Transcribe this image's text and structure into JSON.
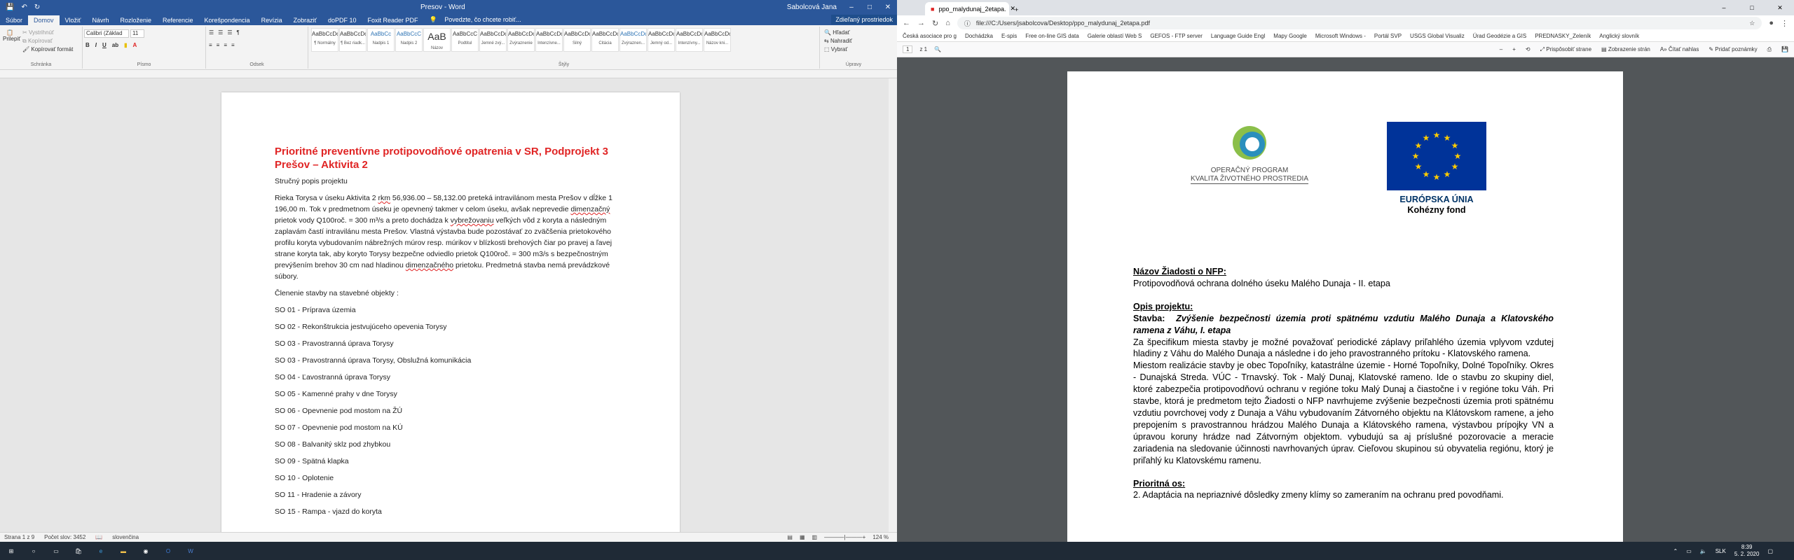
{
  "word": {
    "title": "Presov - Word",
    "user": "Sabolcová Jana",
    "share_label": "Zdieľaný prostriedok",
    "tabs": [
      "Súbor",
      "Domov",
      "Vložiť",
      "Návrh",
      "Rozloženie",
      "Referencie",
      "Korešpondencia",
      "Revízia",
      "Zobraziť",
      "doPDF 10",
      "Foxit Reader PDF"
    ],
    "tell_me": "Povedzte, čo chcete robiť...",
    "clipboard": {
      "paste": "Prilepiť",
      "cut": "Vystrihnúť",
      "copy": "Kopírovať",
      "format": "Kopírovať formát",
      "label": "Schránka"
    },
    "font": {
      "name": "Calibri (Základ",
      "size": "11",
      "label": "Písmo"
    },
    "paragraph_label": "Odsek",
    "styles_label": "Štýly",
    "styles": [
      {
        "preview": "AaBbCcDc",
        "name": "¶ Normálny"
      },
      {
        "preview": "AaBbCcDc",
        "name": "¶ Bez riadk..."
      },
      {
        "preview": "AaBbCc",
        "name": "Nadpis 1"
      },
      {
        "preview": "AaBbCcC",
        "name": "Nadpis 2"
      },
      {
        "preview": "AaB",
        "name": "Názov"
      },
      {
        "preview": "AaBbCcC",
        "name": "Podtitul"
      },
      {
        "preview": "AaBbCcDc",
        "name": "Jemné zvý..."
      },
      {
        "preview": "AaBbCcDc",
        "name": "Zvýraznenie"
      },
      {
        "preview": "AaBbCcDc",
        "name": "Intenzívne..."
      },
      {
        "preview": "AaBbCcDc",
        "name": "Silný"
      },
      {
        "preview": "AaBbCcDc",
        "name": "Citácia"
      },
      {
        "preview": "AaBbCcDc",
        "name": "Zvýraznen..."
      },
      {
        "preview": "AaBbCcDc",
        "name": "Jemný od..."
      },
      {
        "preview": "AaBbCcDc",
        "name": "Intenzívny..."
      },
      {
        "preview": "AaBbCcDc",
        "name": "Názov kni..."
      }
    ],
    "editing": {
      "find": "Hľadať",
      "replace": "Nahradiť",
      "select": "Vybrať",
      "label": "Úpravy"
    },
    "doc": {
      "heading": "Prioritné preventívne protipovodňové opatrenia v SR, Podprojekt 3 Prešov – Aktivita 2",
      "subtitle": "Stručný popis projektu",
      "para1_a": "Rieka Torysa v úseku Aktivita 2 ",
      "para1_b": "rkm",
      "para1_c": " 56,936.00 – 58,132.00 preteká intravilánom mesta Prešov v dĺžke 1 196,00 m. Tok v predmetnom úseku je opevnený takmer v celom úseku, avšak neprevedie ",
      "para1_d": "dimenzačný",
      "para1_e": " prietok vody Q100roč. = 300 m³/s a preto dochádza k ",
      "para1_f": "vybrežovaniu",
      "para1_g": " veľkých vôd z koryta a následným zaplavám častí intravilánu mesta Prešov. Vlastná výstavba bude pozostávať zo zväčšenia prietokového profilu koryta vybudovaním nábrežných múrov resp. múrikov v blízkosti brehových čiar po pravej a ľavej strane koryta tak, aby koryto Torysy bezpečne odviedlo prietok Q100roč. = 300 m3/s  s bezpečnostným prevýšením brehov 30 cm nad hladinou ",
      "para1_h": "dimenzačného",
      "para1_i": " prietoku. Predmetná stavba nemá prevádzkové súbory.",
      "members_intro": "Členenie stavby na stavebné objekty :",
      "objects": [
        "SO 01 - Príprava územia",
        "SO 02 - Rekonštrukcia jestvujúceho opevenia Torysy",
        "SO 03 - Pravostranná úprava Torysy",
        "SO 03 - Pravostranná úprava Torysy, Obslužná komunikácia",
        "SO 04 - Ľavostranná úprava Torysy",
        "SO 05 - Kamenné prahy v dne Torysy",
        "SO 06 - Opevnenie pod mostom na ŽÚ",
        "SO 07 - Opevnenie pod mostom na KÚ",
        "SO 08 - Balvanitý sklz pod zhybkou",
        "SO 09 - Spätná klapka",
        "SO 10 - Oplotenie",
        "SO 11 - Hradenie a závory",
        "SO 15 - Rampa - vjazd do koryta"
      ]
    },
    "status": {
      "page": "Strana 1 z 9",
      "words": "Počet slov: 3452",
      "lang": "slovenčina",
      "zoom": "124 %"
    }
  },
  "chrome": {
    "tab_title": "ppo_malydunaj_2etapa.",
    "url": "file:///C:/Users/jsabolcova/Desktop/ppo_malydunaj_2etapa.pdf",
    "bookmarks": [
      "Česká asociace pro g",
      "Dochádzka",
      "E-spis",
      "Free on-line GIS data",
      "Galerie oblastí Web S",
      "GEFOS - FTP server",
      "Language Guide Engl",
      "Mapy Google",
      "Microsoft Windows -",
      "Portál SVP",
      "USGS Global Visualiz",
      "Úrad Geodézie a GIS",
      "PREDNASKY_Zeleník",
      "Anglický slovník"
    ],
    "pdf_toolbar": {
      "page": "1",
      "total": "z 1",
      "fit": "Prispôsobiť strane",
      "view": "Zobrazenie strán",
      "read": "Čítať nahlas",
      "note": "Pridať poznámky"
    },
    "pdf": {
      "logo_line1": "OPERAČNÝ PROGRAM",
      "logo_line2": "KVALITA ŽIVOTNÉHO PROSTREDIA",
      "eu_line1": "EURÓPSKA ÚNIA",
      "eu_line2": "Kohézny fond",
      "h_name": "Názov Žiadosti o NFP:",
      "name": "Protipovodňová ochrana dolného úseku Malého Dunaja - II. etapa",
      "h_desc": "Opis projektu:",
      "stavba_label": "Stavba:",
      "stavba": "Zvýšenie bezpečnosti územia proti spätnému vzdutiu Malého Dunaja a Klatovského ramena z Váhu, I. etapa",
      "desc": "Za špecifikum miesta stavby je možné považovať periodické záplavy priľahlého územia vplyvom vzdutej hladiny z Váhu do Malého Dunaja a následne i do jeho pravostranného prítoku - Klatovského ramena.",
      "desc2": "Miestom realizácie stavby je obec Topoľníky, katastrálne územie - Horné Topoľníky, Dolné Topoľníky. Okres - Dunajská Streda. VÚC - Trnavský. Tok - Malý Dunaj, Klatovské rameno. Ide o stavbu zo skupiny diel, ktoré zabezpečia protipovodňovú ochranu v regióne toku Malý Dunaj a čiastočne i v regióne toku Váh. Pri stavbe, ktorá je predmetom tejto Žiadosti o NFP navrhujeme zvýšenie bezpečnosti územia proti spätnému vzdutiu povrchovej vody z Dunaja a Váhu vybudovaním Zátvorného objektu na Klátovskom ramene, a jeho prepojením s pravostrannou hrádzou Malého Dunaja a Klátovského ramena, výstavbou prípojky VN a úpravou koruny hrádze nad Zátvorným objektom. vybudujú sa aj príslušné pozorovacie a meracie zariadenia na sledovanie účinnosti navrhovaných úprav. Cieľovou skupinou sú obyvatelia regiónu, ktorý je priľahlý ku Klatovskému ramenu.",
      "h_priority": "Prioritná os:",
      "priority": "2. Adaptácia na nepriaznivé dôsledky zmeny klímy so zameraním na ochranu pred povodňami."
    }
  },
  "taskbar": {
    "lang": "SLK",
    "time": "8:39",
    "date": "5. 2. 2020"
  }
}
